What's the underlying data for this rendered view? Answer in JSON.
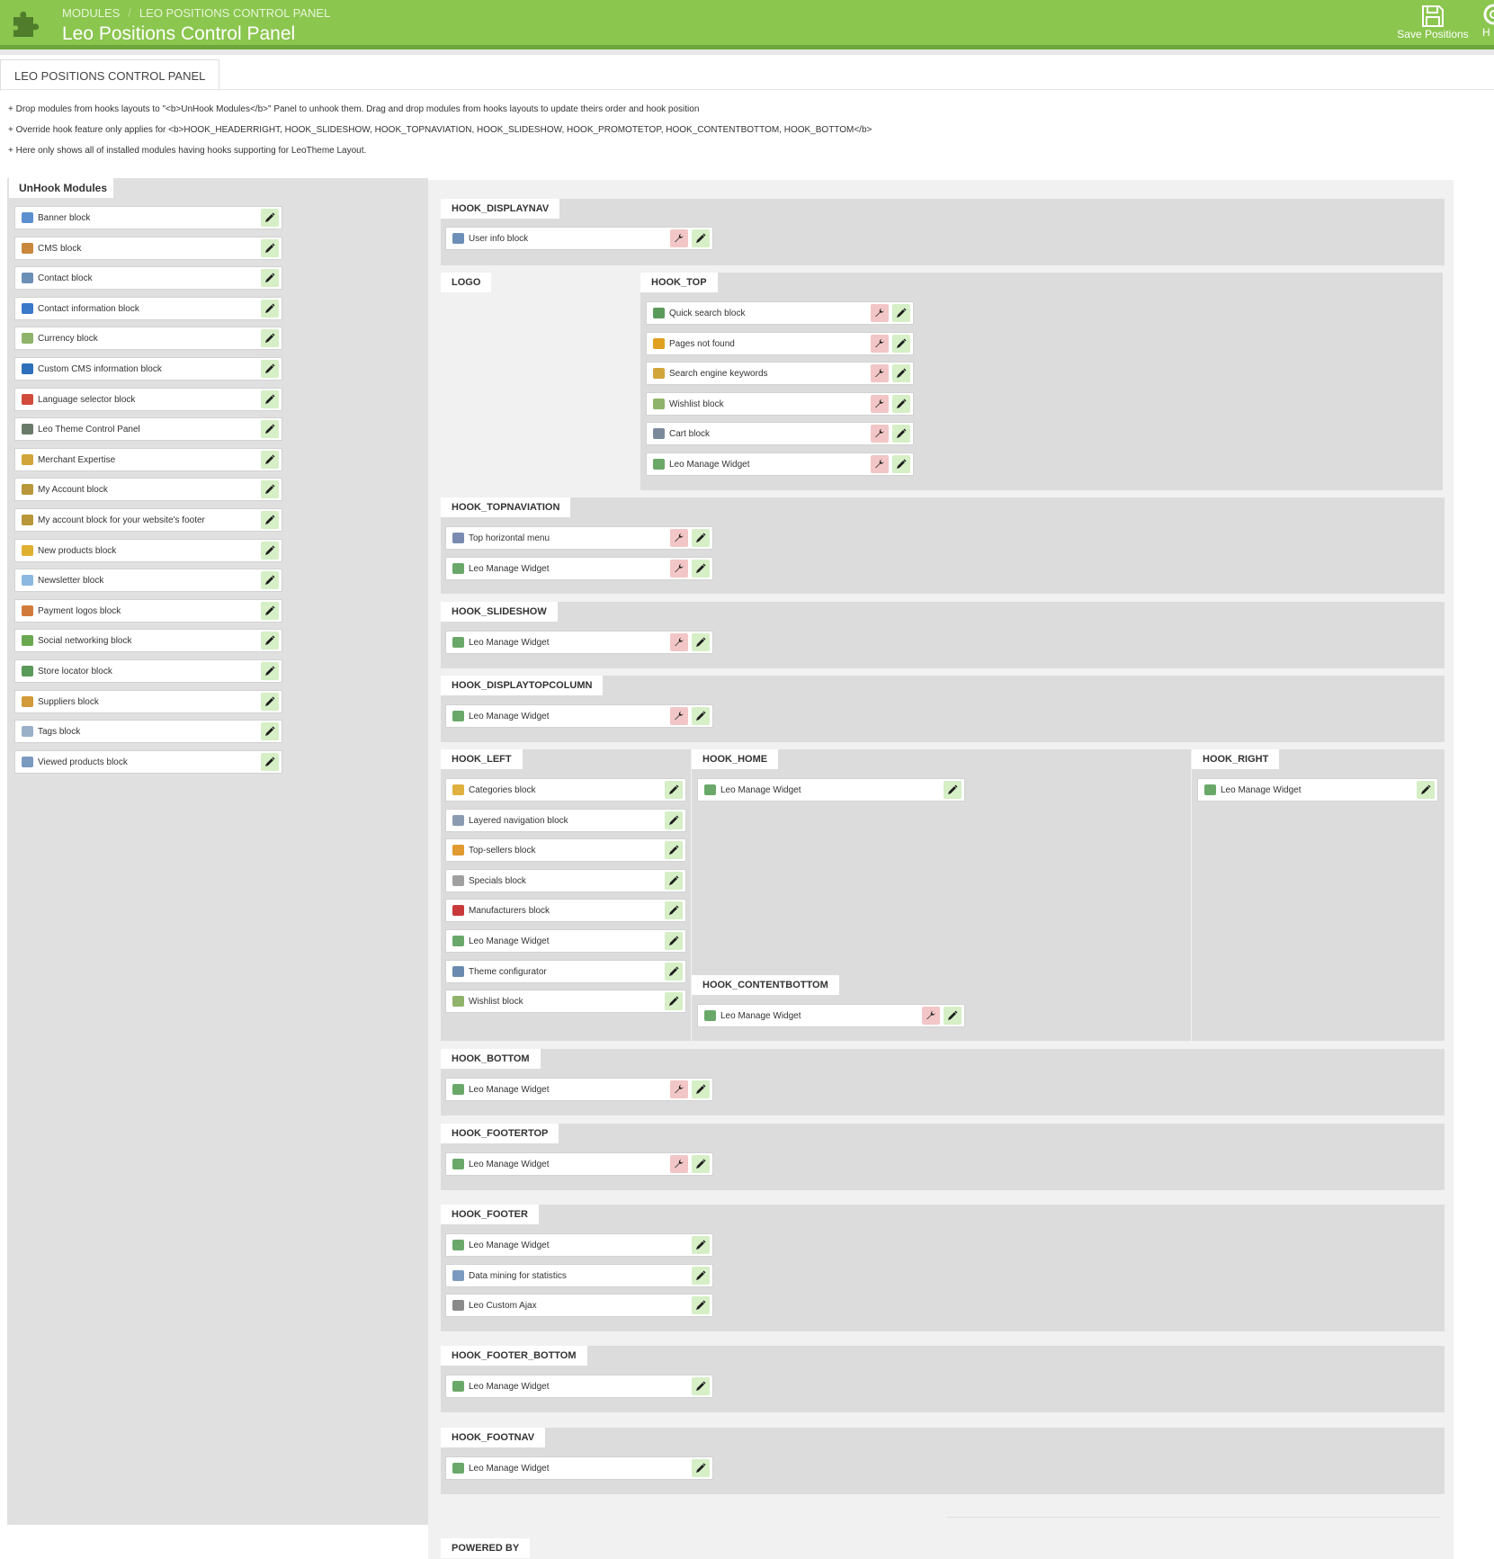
{
  "colors": {
    "topbar": "#8bc64f",
    "edit_button": "#d6efc6",
    "config_button": "#f2c6c6"
  },
  "header": {
    "breadcrumb": [
      "MODULES",
      "LEO POSITIONS CONTROL PANEL"
    ],
    "title": "Leo Positions Control Panel",
    "save_label": "Save Positions",
    "help_label": "H",
    "icons": {
      "logo": "puzzle-icon",
      "save": "floppy-disk-icon",
      "help": "help-icon"
    }
  },
  "tab": {
    "label": "LEO POSITIONS CONTROL PANEL"
  },
  "notes": [
    "+ Drop modules from hooks layouts to \"<b>UnHook Modules</b>\" Panel to unhook them. Drag and drop modules from hooks layouts to update theirs order and hook position",
    "+ Override hook feature only applies for <b>HOOK_HEADERRIGHT, HOOK_SLIDESHOW, HOOK_TOPNAVIATION, HOOK_SLIDESHOW, HOOK_PROMOTETOP, HOOK_CONTENTBOTTOM, HOOK_BOTTOM</b>",
    "+ Here only shows all of installed modules having hooks supporting for LeoTheme Layout."
  ],
  "unhook": {
    "title": "UnHook Modules",
    "modules": [
      {
        "name": "Banner block",
        "icon": "banner-icon",
        "color": "#5a8fd0"
      },
      {
        "name": "CMS block",
        "icon": "cms-icon",
        "color": "#c8873c"
      },
      {
        "name": "Contact block",
        "icon": "contact-icon",
        "color": "#6c8fb8"
      },
      {
        "name": "Contact information block",
        "icon": "info-icon",
        "color": "#3a78c9"
      },
      {
        "name": "Currency block",
        "icon": "currency-icon",
        "color": "#8fb36a"
      },
      {
        "name": "Custom CMS information block",
        "icon": "info-icon",
        "color": "#2d6fb8"
      },
      {
        "name": "Language selector block",
        "icon": "language-icon",
        "color": "#d24b3a"
      },
      {
        "name": "Leo Theme Control Panel",
        "icon": "leo-icon",
        "color": "#6a7a6a"
      },
      {
        "name": "Merchant Expertise",
        "icon": "merchant-icon",
        "color": "#d2a53a"
      },
      {
        "name": "My Account block",
        "icon": "account-icon",
        "color": "#b8963a"
      },
      {
        "name": "My account block for your website's footer",
        "icon": "account-icon",
        "color": "#b8963a"
      },
      {
        "name": "New products block",
        "icon": "new-products-icon",
        "color": "#e0b030"
      },
      {
        "name": "Newsletter block",
        "icon": "newsletter-icon",
        "color": "#8ab8e0"
      },
      {
        "name": "Payment logos block",
        "icon": "payment-icon",
        "color": "#d27a3a"
      },
      {
        "name": "Social networking block",
        "icon": "social-icon",
        "color": "#6aa84f"
      },
      {
        "name": "Store locator block",
        "icon": "store-icon",
        "color": "#5a9a5a"
      },
      {
        "name": "Suppliers block",
        "icon": "suppliers-icon",
        "color": "#d29a3a"
      },
      {
        "name": "Tags block",
        "icon": "tags-icon",
        "color": "#9ab0c8"
      },
      {
        "name": "Viewed products block",
        "icon": "viewed-icon",
        "color": "#7a9ac0"
      }
    ]
  },
  "hooks": {
    "displaynav": {
      "label": "HOOK_DISPLAYNAV",
      "modules": [
        {
          "name": "User info block",
          "icon": "user-info-icon",
          "color": "#6c8fb8",
          "config": true
        }
      ]
    },
    "logo": {
      "label": "LOGO"
    },
    "top": {
      "label": "HOOK_TOP",
      "modules": [
        {
          "name": "Quick search block",
          "icon": "search-icon",
          "color": "#5a9a5a",
          "config": true
        },
        {
          "name": "Pages not found",
          "icon": "warning-icon",
          "color": "#e0a020",
          "config": true
        },
        {
          "name": "Search engine keywords",
          "icon": "keywords-icon",
          "color": "#d2a53a",
          "config": true
        },
        {
          "name": "Wishlist block",
          "icon": "wishlist-icon",
          "color": "#8fb36a",
          "config": true
        },
        {
          "name": "Cart block",
          "icon": "cart-icon",
          "color": "#7a8a9a",
          "config": true
        },
        {
          "name": "Leo Manage Widget",
          "icon": "widget-icon",
          "color": "#6aa86a",
          "config": true
        }
      ]
    },
    "topnav": {
      "label": "HOOK_TOPNAVIATION",
      "modules": [
        {
          "name": "Top horizontal menu",
          "icon": "menu-icon",
          "color": "#7a8ab0",
          "config": true
        },
        {
          "name": "Leo Manage Widget",
          "icon": "widget-icon",
          "color": "#6aa86a",
          "config": true
        }
      ]
    },
    "slideshow": {
      "label": "HOOK_SLIDESHOW",
      "modules": [
        {
          "name": "Leo Manage Widget",
          "icon": "widget-icon",
          "color": "#6aa86a",
          "config": true
        }
      ]
    },
    "topcolumn": {
      "label": "HOOK_DISPLAYTOPCOLUMN",
      "modules": [
        {
          "name": "Leo Manage Widget",
          "icon": "widget-icon",
          "color": "#6aa86a",
          "config": true
        }
      ]
    },
    "left": {
      "label": "HOOK_LEFT",
      "modules": [
        {
          "name": "Categories block",
          "icon": "folder-icon",
          "color": "#e0b040",
          "config": false
        },
        {
          "name": "Layered navigation block",
          "icon": "layered-icon",
          "color": "#8a9ab0",
          "config": false
        },
        {
          "name": "Top-sellers block",
          "icon": "top-sellers-icon",
          "color": "#e09a30",
          "config": false
        },
        {
          "name": "Specials block",
          "icon": "specials-icon",
          "color": "#a0a0a0",
          "config": false
        },
        {
          "name": "Manufacturers block",
          "icon": "manufacturers-icon",
          "color": "#c83a3a",
          "config": false
        },
        {
          "name": "Leo Manage Widget",
          "icon": "widget-icon",
          "color": "#6aa86a",
          "config": false
        },
        {
          "name": "Theme configurator",
          "icon": "theme-config-icon",
          "color": "#6a8ab0",
          "config": false
        },
        {
          "name": "Wishlist block",
          "icon": "wishlist-icon",
          "color": "#8fb36a",
          "config": false
        }
      ]
    },
    "home": {
      "label": "HOOK_HOME",
      "modules": [
        {
          "name": "Leo Manage Widget",
          "icon": "widget-icon",
          "color": "#6aa86a",
          "config": false
        }
      ]
    },
    "right": {
      "label": "HOOK_RIGHT",
      "modules": [
        {
          "name": "Leo Manage Widget",
          "icon": "widget-icon",
          "color": "#6aa86a",
          "config": false
        }
      ]
    },
    "contentbottom": {
      "label": "HOOK_CONTENTBOTTOM",
      "modules": [
        {
          "name": "Leo Manage Widget",
          "icon": "widget-icon",
          "color": "#6aa86a",
          "config": true
        }
      ]
    },
    "bottom": {
      "label": "HOOK_BOTTOM",
      "modules": [
        {
          "name": "Leo Manage Widget",
          "icon": "widget-icon",
          "color": "#6aa86a",
          "config": true
        }
      ]
    },
    "footertop": {
      "label": "HOOK_FOOTERTOP",
      "modules": [
        {
          "name": "Leo Manage Widget",
          "icon": "widget-icon",
          "color": "#6aa86a",
          "config": true
        }
      ]
    },
    "footer": {
      "label": "HOOK_FOOTER",
      "modules": [
        {
          "name": "Leo Manage Widget",
          "icon": "widget-icon",
          "color": "#6aa86a",
          "config": false
        },
        {
          "name": "Data mining for statistics",
          "icon": "statistics-icon",
          "color": "#7a9ac0",
          "config": false
        },
        {
          "name": "Leo Custom Ajax",
          "icon": "ajax-icon",
          "color": "#8a8a8a",
          "config": false
        }
      ]
    },
    "footerbottom": {
      "label": "HOOK_FOOTER_BOTTOM",
      "modules": [
        {
          "name": "Leo Manage Widget",
          "icon": "widget-icon",
          "color": "#6aa86a",
          "config": false
        }
      ]
    },
    "footnav": {
      "label": "HOOK_FOOTNAV",
      "modules": [
        {
          "name": "Leo Manage Widget",
          "icon": "widget-icon",
          "color": "#6aa86a",
          "config": false
        }
      ]
    },
    "powered": {
      "label": "POWERED BY"
    }
  }
}
